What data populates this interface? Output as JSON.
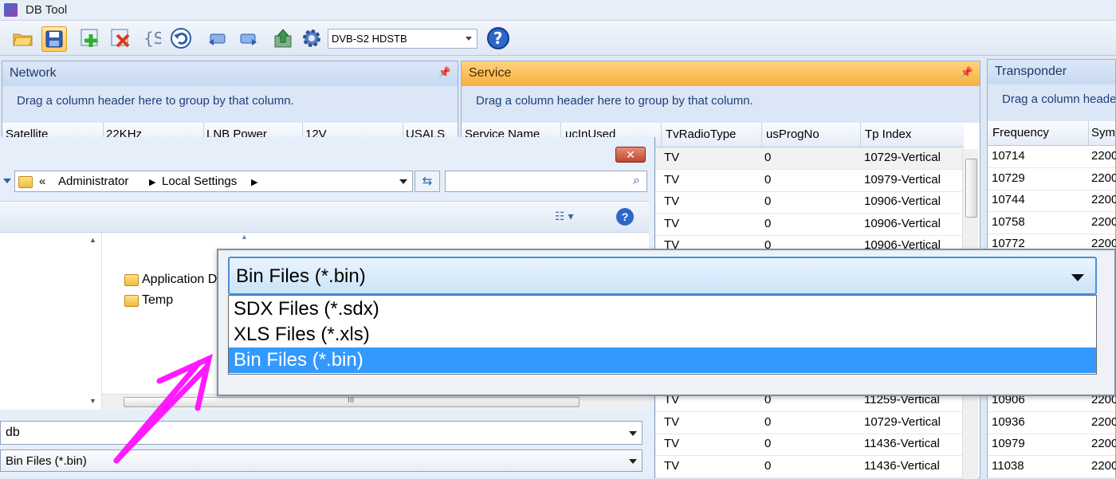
{
  "app": {
    "title": "DB Tool"
  },
  "toolbar": {
    "icons": [
      "open-folder-icon",
      "save-icon",
      "add-icon",
      "delete-icon",
      "script-icon",
      "undo-icon",
      "export-left-icon",
      "export-right-icon",
      "upload-icon",
      "gear-icon"
    ],
    "device_select": "DVB-S2 HDSTB",
    "help_icon": "help-icon"
  },
  "network_panel": {
    "title": "Network",
    "group_hint": "Drag a column header here to group by that column.",
    "columns": [
      "Satellite",
      "22KHz",
      "LNB Power",
      "12V",
      "USALS"
    ]
  },
  "service_panel": {
    "title": "Service",
    "group_hint": "Drag a column header here to group by that column.",
    "columns": [
      "Service Name",
      "ucInUsed",
      "TvRadioType",
      "usProgNo",
      "Tp Index"
    ],
    "rows_top": [
      {
        "type": "TV",
        "prog": "0",
        "tp": "10729-Vertical"
      },
      {
        "type": "TV",
        "prog": "0",
        "tp": "10979-Vertical"
      },
      {
        "type": "TV",
        "prog": "0",
        "tp": "10906-Vertical"
      },
      {
        "type": "TV",
        "prog": "0",
        "tp": "10906-Vertical"
      },
      {
        "type": "TV",
        "prog": "0",
        "tp": "10906-Vertical"
      }
    ],
    "rows_bottom": [
      {
        "type": "TV",
        "prog": "0",
        "tp": "11259-Vertical"
      },
      {
        "type": "TV",
        "prog": "0",
        "tp": "10729-Vertical"
      },
      {
        "type": "TV",
        "prog": "0",
        "tp": "11436-Vertical"
      },
      {
        "type": "TV",
        "prog": "0",
        "tp": "11436-Vertical"
      }
    ]
  },
  "transponder_panel": {
    "title": "Transponder",
    "group_hint": "Drag a column heade",
    "columns": [
      "Frequency",
      "Sym"
    ],
    "rows_top": [
      {
        "freq": "10714",
        "sym": "2200"
      },
      {
        "freq": "10729",
        "sym": "2200"
      },
      {
        "freq": "10744",
        "sym": "2200"
      },
      {
        "freq": "10758",
        "sym": "2200"
      },
      {
        "freq": "10772",
        "sym": "2200"
      }
    ],
    "rows_bottom": [
      {
        "freq": "10906",
        "sym": "2200"
      },
      {
        "freq": "10936",
        "sym": "2200"
      },
      {
        "freq": "10979",
        "sym": "2200"
      },
      {
        "freq": "11038",
        "sym": "2200"
      }
    ]
  },
  "dialog": {
    "close_glyph": "✕",
    "breadcrumb_prefix": "«",
    "path": [
      "Administrator",
      "Local Settings"
    ],
    "folders": [
      "Application D",
      "Temp"
    ],
    "filename": "db",
    "filetype": "Bin Files (*.bin)",
    "scroll_glyph": "III"
  },
  "filetype_dropdown": {
    "selected": "Bin Files (*.bin)",
    "options": [
      "SDX Files (*.sdx)",
      "XLS Files (*.xls)",
      "Bin Files (*.bin)"
    ],
    "highlighted_index": 2
  },
  "colors": {
    "accent_selection": "#3399ff",
    "annotation_arrow": "#ff1aff",
    "service_header": "#f7b13c"
  }
}
